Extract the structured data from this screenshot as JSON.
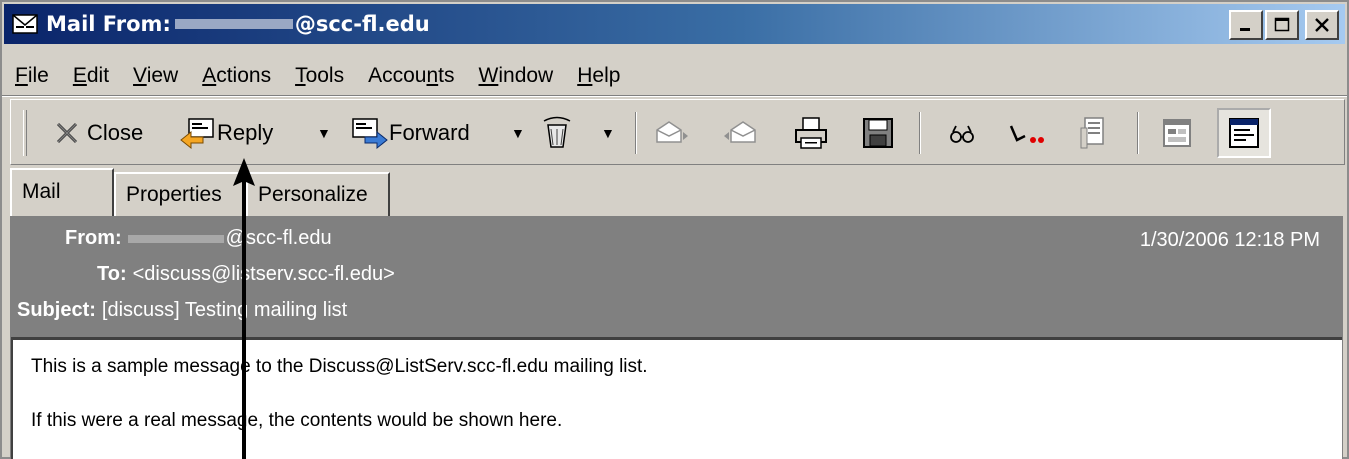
{
  "window": {
    "title_prefix": "Mail From:",
    "title_suffix": "@scc-fl.edu",
    "buttons": [
      "minimize",
      "maximize",
      "close"
    ]
  },
  "menu": {
    "items": [
      {
        "pre": "",
        "ul": "F",
        "post": "ile"
      },
      {
        "pre": "",
        "ul": "E",
        "post": "dit"
      },
      {
        "pre": "",
        "ul": "V",
        "post": "iew"
      },
      {
        "pre": "",
        "ul": "A",
        "post": "ctions"
      },
      {
        "pre": "",
        "ul": "T",
        "post": "ools"
      },
      {
        "pre": "Accou",
        "ul": "n",
        "post": "ts"
      },
      {
        "pre": "",
        "ul": "W",
        "post": "indow"
      },
      {
        "pre": "",
        "ul": "H",
        "post": "elp"
      }
    ]
  },
  "toolbar": {
    "close_label": "Close",
    "reply_label": "Reply",
    "forward_label": "Forward"
  },
  "tabs": [
    "Mail",
    "Properties",
    "Personalize"
  ],
  "message": {
    "from_label": "From:",
    "from_value": "@scc-fl.edu",
    "to_label": "To:",
    "to_value": "<discuss@listserv.scc-fl.edu>",
    "subject_label": "Subject:",
    "subject_value": "[discuss] Testing mailing list",
    "date": "1/30/2006 12:18 PM",
    "body_lines": [
      "This is a sample message to the Discuss@ListServ.scc-fl.edu mailing list.",
      "If this were a real message, the contents would be shown here."
    ]
  },
  "icons": {
    "title": "mail-envelope-icon",
    "close": "x-icon",
    "reply": "reply-icon",
    "forward": "forward-icon",
    "delete": "trash-icon",
    "previous": "previous-message-icon",
    "next": "next-message-icon",
    "print": "printer-icon",
    "save": "floppy-disk-icon",
    "find": "binoculars-icon",
    "flag": "flag-icon",
    "properties": "properties-icon",
    "view1": "view-pane-icon",
    "view2": "reading-pane-icon"
  },
  "colors": {
    "titlebar_start": "#0a246a",
    "titlebar_end": "#a6caf0",
    "header_bg": "#808080",
    "chrome": "#d4d0c8"
  }
}
